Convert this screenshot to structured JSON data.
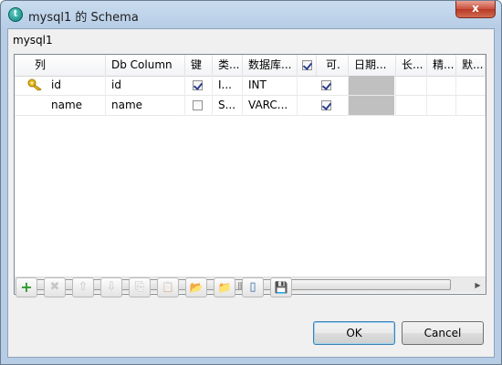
{
  "window": {
    "title": "mysql1 的 Schema",
    "icon": "talend-app-icon",
    "close_label": "x"
  },
  "schema_label": "mysql1",
  "table": {
    "columns": [
      "列",
      "Db Column",
      "键",
      "类...",
      "数据库...",
      "",
      "可.",
      "日期...",
      "长...",
      "精...",
      "默..."
    ],
    "rows": [
      {
        "name": "id",
        "db_column": "id",
        "key": true,
        "type": "I...",
        "db_type": "INT",
        "nullable": true,
        "has_key_icon": true
      },
      {
        "name": "name",
        "db_column": "name",
        "key": false,
        "type": "S...",
        "db_type": "VARC...",
        "nullable": true,
        "has_key_icon": false
      }
    ],
    "header_checkbox_checked": true
  },
  "toolbar": {
    "buttons": [
      {
        "name": "add-row-button",
        "glyph": "+",
        "enabled": true
      },
      {
        "name": "remove-row-button",
        "glyph": "✖",
        "enabled": false
      },
      {
        "name": "move-up-button",
        "glyph": "⇧",
        "enabled": false
      },
      {
        "name": "move-down-button",
        "glyph": "⇩",
        "enabled": false
      },
      {
        "name": "copy-button",
        "glyph": "⎘",
        "enabled": false
      },
      {
        "name": "paste-button",
        "glyph": "📋",
        "enabled": false
      },
      {
        "name": "import-button",
        "glyph": "📂",
        "enabled": true
      },
      {
        "name": "export-button",
        "glyph": "📁",
        "enabled": true
      },
      {
        "name": "reset-db-types-button",
        "glyph": "▯",
        "enabled": true
      },
      {
        "name": "save-button",
        "glyph": "💾",
        "enabled": true
      }
    ]
  },
  "buttons": {
    "ok": "OK",
    "cancel": "Cancel"
  },
  "colors": {
    "title_bar": "#b7cde6",
    "close_button": "#c9513d",
    "disabled_cell": "#c0c0c0",
    "checkbox_check": "#2a3f8c"
  }
}
